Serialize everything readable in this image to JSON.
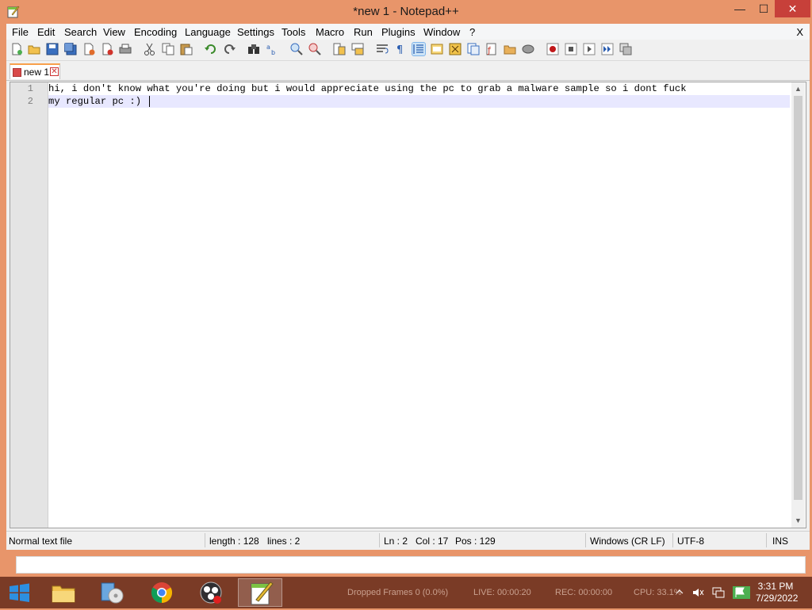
{
  "window": {
    "title": "*new 1 - Notepad++",
    "controls": {
      "minimize": "—",
      "maximize": "☐",
      "close": "✕"
    }
  },
  "menu": {
    "items": [
      "File",
      "Edit",
      "Search",
      "View",
      "Encoding",
      "Language",
      "Settings",
      "Tools",
      "Macro",
      "Run",
      "Plugins",
      "Window",
      "?"
    ],
    "close_doc": "X"
  },
  "toolbar": {
    "icons": [
      "new-file-icon",
      "open-file-icon",
      "save-icon",
      "save-all-icon",
      "close-icon",
      "close-all-icon",
      "print-icon",
      "cut-icon",
      "copy-icon",
      "paste-icon",
      "undo-icon",
      "redo-icon",
      "find-icon",
      "replace-icon",
      "zoom-in-icon",
      "zoom-out-icon",
      "sync-vertical-icon",
      "sync-horizontal-icon",
      "word-wrap-icon",
      "show-all-chars-icon",
      "indent-guide-icon",
      "user-defined-language-icon",
      "document-map-icon",
      "function-list-icon",
      "folder-as-workspace-icon",
      "monitoring-icon",
      "record-macro-icon",
      "stop-macro-icon",
      "play-macro-icon",
      "run-macro-multiple-icon",
      "save-macro-icon"
    ],
    "active_icon": "indent-guide-icon"
  },
  "tabs": [
    {
      "label": "new 1",
      "close": "✕"
    }
  ],
  "editor": {
    "line_numbers": [
      "1",
      "2"
    ],
    "lines": [
      "hi, i don't know what you're doing but i would appreciate using the pc to grab a malware sample so i dont fuck",
      "my regular pc :)"
    ],
    "scroll_up": "▲",
    "scroll_down": "▼"
  },
  "status": {
    "file_type": "Normal text file",
    "length": "length : 128",
    "lines": "lines : 2",
    "ln": "Ln : 2",
    "col": "Col : 17",
    "pos": "Pos : 129",
    "eol": "Windows (CR LF)",
    "encoding": "UTF-8",
    "mode": "INS"
  },
  "taskbar": {
    "apps": [
      "file-explorer-icon",
      "media-disc-icon",
      "chrome-icon",
      "obs-icon",
      "notepadpp-icon"
    ],
    "active_app": "notepadpp-icon",
    "obs_status": {
      "dropped": "Dropped Frames 0 (0.0%)",
      "live": "LIVE: 00:00:20",
      "rec": "REC: 00:00:00",
      "cpu": "CPU: 33.1%"
    },
    "clock_time": "3:31 PM",
    "clock_date": "7/29/2022"
  },
  "colors": {
    "window_frame": "#e8956a",
    "taskbar": "#7a3b26",
    "tab_accent": "#f8a04b",
    "current_line": "#e8e8ff",
    "close_button": "#c7403a"
  }
}
